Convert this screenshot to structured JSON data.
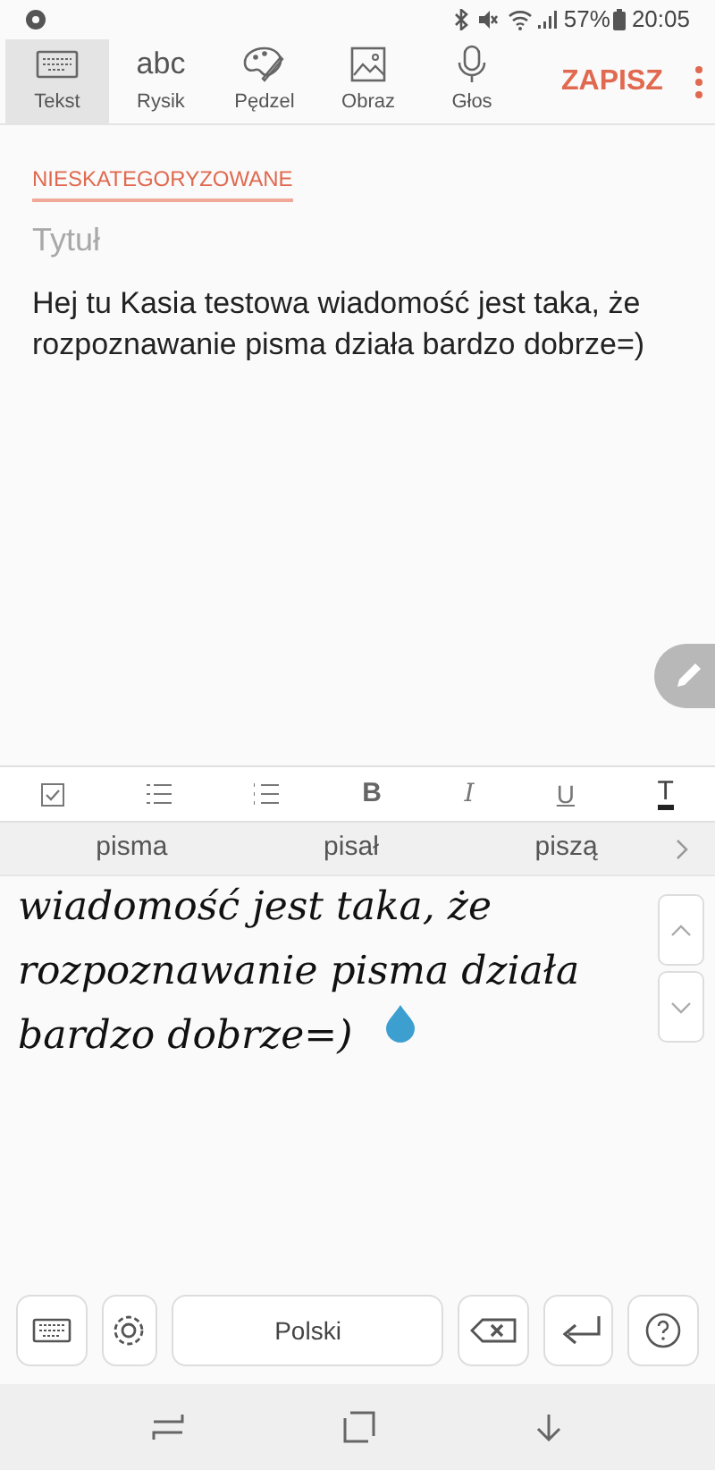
{
  "status_bar": {
    "battery": "57%",
    "time": "20:05"
  },
  "toolbar": {
    "tabs": [
      {
        "label": "Tekst",
        "selected": true,
        "kind": "keyboard"
      },
      {
        "label": "Rysik",
        "selected": false,
        "kind": "abc",
        "glyph": "abc"
      },
      {
        "label": "Pędzel",
        "selected": false,
        "kind": "palette"
      },
      {
        "label": "Obraz",
        "selected": false,
        "kind": "image"
      },
      {
        "label": "Głos",
        "selected": false,
        "kind": "mic"
      }
    ],
    "save": "ZAPISZ"
  },
  "note": {
    "category": "NIESKATEGORYZOWANE",
    "title_placeholder": "Tytuł",
    "body": "Hej tu Kasia testowa wiadomość jest taka, że rozpoznawanie pisma działa bardzo dobrze=)"
  },
  "format_toolbar": [
    {
      "kind": "checklist"
    },
    {
      "kind": "bullets"
    },
    {
      "kind": "numbered"
    },
    {
      "kind": "bold",
      "label": "B"
    },
    {
      "kind": "italic",
      "label": "I"
    },
    {
      "kind": "underline",
      "label": "U"
    },
    {
      "kind": "color",
      "label": "T"
    }
  ],
  "suggestions": [
    "pisma",
    "pisał",
    "piszą"
  ],
  "handwriting": {
    "lines": [
      "wiadomość jest taka, że",
      "rozpoznawanie pisma działa",
      "bardzo dobrze=)"
    ]
  },
  "keyboard": {
    "language": "Polski"
  }
}
